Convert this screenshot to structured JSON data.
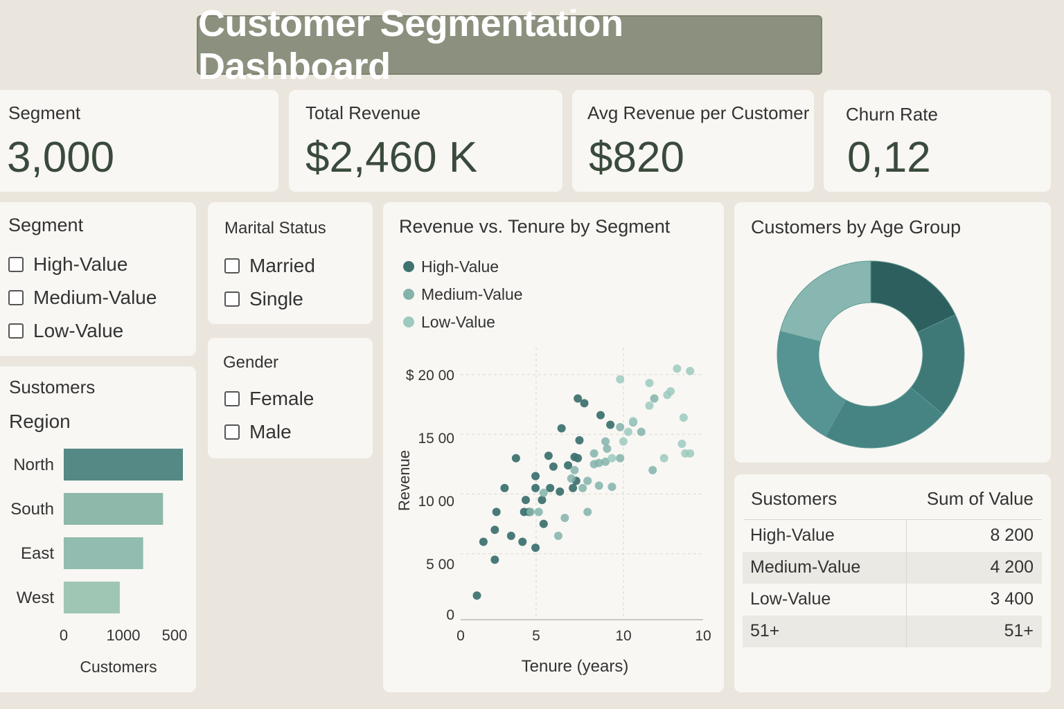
{
  "header": {
    "title": "Customer Segmentation Dashboard"
  },
  "kpis": [
    {
      "label": "Segment",
      "value": "3,000"
    },
    {
      "label": "Total Revenue",
      "value": "$2,460 K"
    },
    {
      "label": "Avg Revenue per Customer",
      "value": "$820"
    },
    {
      "label": "Churn Rate",
      "value": "0,12"
    }
  ],
  "filters": {
    "segment": {
      "title": "Segment",
      "options": [
        "High-Value",
        "Medium-Value",
        "Low-Value"
      ]
    },
    "marital": {
      "title": "Marital Status",
      "options": [
        "Married",
        "Single"
      ]
    },
    "gender": {
      "title": "Gender",
      "options": [
        "Female",
        "Male"
      ]
    }
  },
  "region_chart": {
    "title_line1": "Sustomers",
    "title_line2": "Region",
    "xlabel": "Customers",
    "tick_labels": [
      "0",
      "1000",
      "500"
    ]
  },
  "scatter_chart": {
    "title": "Revenue vs. Tenure by Segment",
    "xlabel": "Tenure (years)",
    "ylabel": "Revenue",
    "x_tick_labels": [
      "0",
      "5",
      "10",
      "10"
    ],
    "y_tick_labels": [
      "0",
      "5 00",
      "10 00",
      "15 00",
      "$ 20 00"
    ],
    "legend": [
      "High-Value",
      "Medium-Value",
      "Low-Value"
    ]
  },
  "donut_chart": {
    "title": "Customers by Age Group"
  },
  "summary_table": {
    "headers": [
      "Sustomers",
      "Sum of Value"
    ],
    "rows": [
      [
        "High-Value",
        "8 200"
      ],
      [
        "Medium-Value",
        "4 200"
      ],
      [
        "Low-Value",
        "3 400"
      ],
      [
        "51+",
        "51+"
      ]
    ]
  },
  "colors": {
    "background": "#ebe6dd",
    "card": "#f8f7f3",
    "title_bar": "#8c917f",
    "kpi_value": "#3a4a3c",
    "high_value": "#3f7371",
    "medium_value": "#83b3aa",
    "low_value": "#9ccabf",
    "bar_north": "#558985",
    "bar_south": "#8db8aa",
    "bar_east": "#91bcaf",
    "bar_west": "#9fc6b4"
  },
  "chart_data": [
    {
      "type": "bar",
      "orientation": "horizontal",
      "categories": [
        "North",
        "South",
        "East",
        "West"
      ],
      "values": [
        1020,
        850,
        680,
        480
      ],
      "xlabel": "Customers",
      "xlim": [
        0,
        1020
      ]
    },
    {
      "type": "scatter",
      "title": "Revenue vs. Tenure by Segment",
      "xlabel": "Tenure (years)",
      "ylabel": "Revenue",
      "xlim": [
        0,
        14.9
      ],
      "ylim": [
        0,
        2000
      ],
      "grid": true,
      "legend_position": "top-left",
      "series": [
        {
          "name": "High-Value",
          "points": [
            [
              1.0,
              150
            ],
            [
              1.4,
              600
            ],
            [
              2.1,
              450
            ],
            [
              2.1,
              700
            ],
            [
              2.2,
              850
            ],
            [
              2.7,
              1050
            ],
            [
              3.1,
              650
            ],
            [
              3.4,
              1300
            ],
            [
              3.8,
              600
            ],
            [
              3.9,
              850
            ],
            [
              4.0,
              950
            ],
            [
              4.2,
              850
            ],
            [
              4.6,
              550
            ],
            [
              4.6,
              1050
            ],
            [
              4.6,
              1150
            ],
            [
              5.0,
              950
            ],
            [
              5.1,
              750
            ],
            [
              5.4,
              1320
            ],
            [
              5.5,
              1050
            ],
            [
              5.7,
              1230
            ],
            [
              6.1,
              1020
            ],
            [
              6.2,
              1550
            ],
            [
              6.6,
              1240
            ],
            [
              6.9,
              1050
            ],
            [
              7.0,
              1310
            ],
            [
              7.1,
              1110
            ],
            [
              7.2,
              1300
            ],
            [
              7.3,
              1450
            ],
            [
              7.6,
              1760
            ],
            [
              8.6,
              1660
            ],
            [
              9.2,
              1580
            ],
            [
              7.2,
              1800
            ]
          ]
        },
        {
          "name": "Medium-Value",
          "points": [
            [
              4.3,
              850
            ],
            [
              4.8,
              850
            ],
            [
              5.1,
              1010
            ],
            [
              6.0,
              650
            ],
            [
              6.4,
              800
            ],
            [
              6.8,
              1130
            ],
            [
              7.0,
              1200
            ],
            [
              7.5,
              1050
            ],
            [
              7.8,
              1110
            ],
            [
              7.8,
              850
            ],
            [
              8.2,
              1250
            ],
            [
              8.2,
              1340
            ],
            [
              8.5,
              1070
            ],
            [
              8.5,
              1260
            ],
            [
              8.9,
              1270
            ],
            [
              8.9,
              1440
            ],
            [
              9.0,
              1380
            ],
            [
              9.3,
              1060
            ],
            [
              9.8,
              1300
            ],
            [
              9.8,
              1560
            ],
            [
              10.6,
              1600
            ],
            [
              11.1,
              1520
            ],
            [
              11.8,
              1200
            ],
            [
              11.9,
              1800
            ]
          ]
        },
        {
          "name": "Low-Value",
          "points": [
            [
              9.3,
              1300
            ],
            [
              10.0,
              1440
            ],
            [
              10.3,
              1520
            ],
            [
              10.6,
              1610
            ],
            [
              11.6,
              1740
            ],
            [
              11.6,
              1930
            ],
            [
              12.7,
              1830
            ],
            [
              12.9,
              1860
            ],
            [
              13.6,
              1420
            ],
            [
              13.7,
              1640
            ],
            [
              13.8,
              1340
            ],
            [
              14.1,
              2030
            ],
            [
              12.5,
              1300
            ],
            [
              14.1,
              1340
            ],
            [
              13.3,
              2050
            ],
            [
              9.8,
              1960
            ]
          ]
        }
      ]
    },
    {
      "type": "pie",
      "variant": "donut",
      "title": "Customers by Age Group",
      "labels": [],
      "values": [
        18,
        18,
        22,
        21,
        21
      ],
      "colors": [
        "#2e5f5f",
        "#3e7877",
        "#468383",
        "#569393",
        "#87b7b0"
      ]
    }
  ]
}
